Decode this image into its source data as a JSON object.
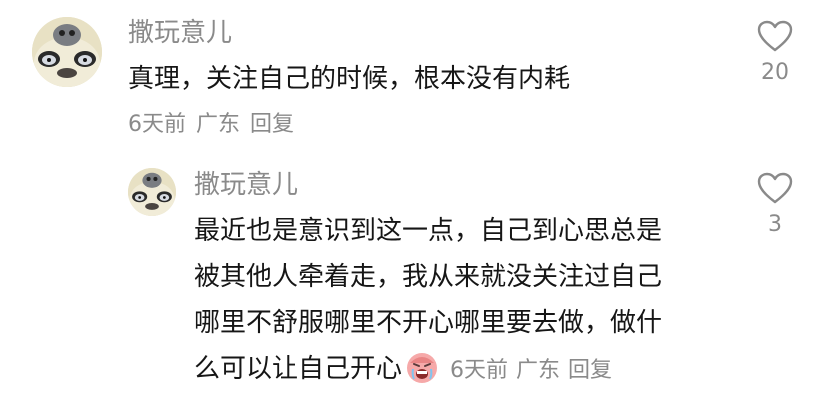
{
  "comment": {
    "username": "撒玩意儿",
    "text": "真理，关注自己的时候，根本没有内耗",
    "time": "6天前",
    "location": "广东",
    "reply_label": "回复",
    "likes": "20"
  },
  "reply": {
    "username": "撒玩意儿",
    "lines": [
      "最近也是意识到这一点，自己到心思总是",
      "被其他人牵着走，我从来就没关注过自己",
      "哪里不舒服哪里不开心哪里要去做，做什",
      "么可以让自己开心"
    ],
    "emoji": "crying-face-sticker",
    "time": "6天前",
    "location": "广东",
    "reply_label": "回复",
    "likes": "3"
  }
}
